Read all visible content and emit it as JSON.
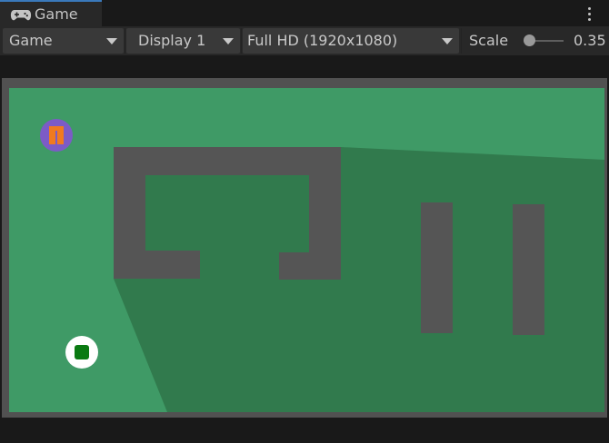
{
  "tab": {
    "title": "Game",
    "icon": "gamepad-icon"
  },
  "menu": {
    "icon": "kebab-menu-icon"
  },
  "toolbar": {
    "display_mode": "Game",
    "display": "Display 1",
    "resolution": "Full HD (1920x1080)",
    "scale_label": "Scale",
    "scale_value": "0.35"
  },
  "game": {
    "colors": {
      "lit_floor": "#3f9a66",
      "shadow_floor": "#317a4d",
      "wall": "#555555",
      "frame": "#515151",
      "player_ring": "#ffffff",
      "player_core": "#0a7a12",
      "pause_badge": "#7c5bc6",
      "pause_bars": "#f07a20"
    },
    "pause_button_icon": "pause-icon",
    "player_icon": "player-ring-icon"
  }
}
